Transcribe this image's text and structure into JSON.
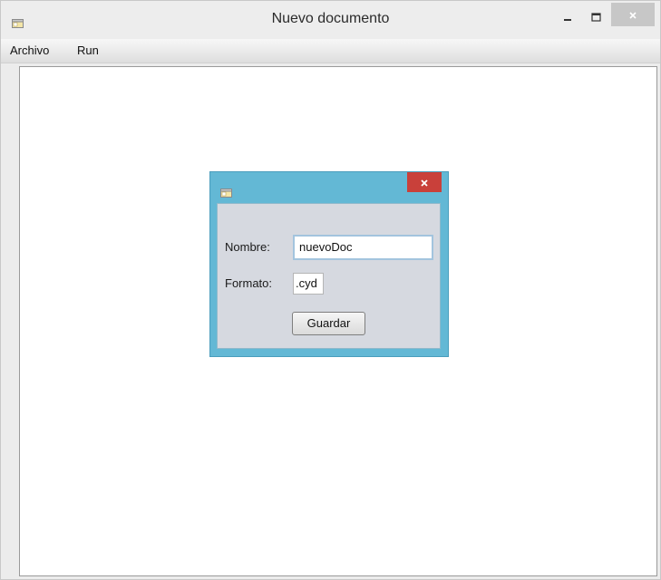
{
  "window": {
    "title": "Nuevo documento",
    "icon": "app-window-icon",
    "controls": {
      "minimize": "minimize-icon",
      "maximize": "maximize-icon",
      "close": "close-icon"
    }
  },
  "menubar": {
    "items": [
      {
        "label": "Archivo"
      },
      {
        "label": "Run"
      }
    ]
  },
  "dialog": {
    "icon": "app-window-icon",
    "close_icon": "close-icon",
    "nombre_label": "Nombre:",
    "nombre_value": "nuevoDoc",
    "formato_label": "Formato:",
    "formato_value": ".cyd",
    "guardar_label": "Guardar"
  },
  "colors": {
    "dialog_frame": "#63b8d5",
    "dialog_close": "#c9403a",
    "dialog_body": "#d6d9e0"
  }
}
